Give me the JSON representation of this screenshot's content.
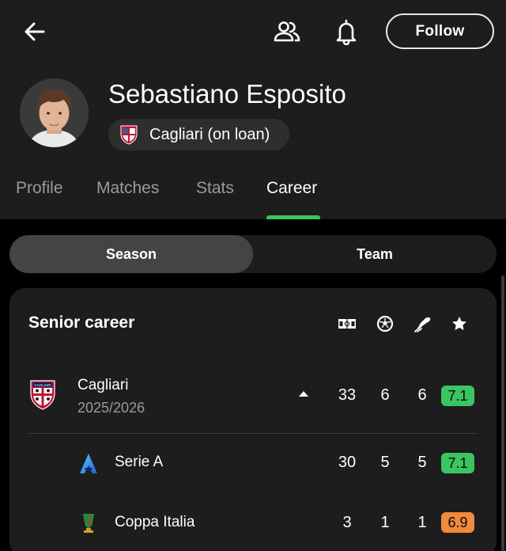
{
  "header": {
    "follow_label": "Follow",
    "icons": {
      "back": "arrow-left-icon",
      "people": "people-icon",
      "bell": "bell-icon"
    }
  },
  "player": {
    "name": "Sebastiano Esposito",
    "team_chip": "Cagliari (on loan)"
  },
  "tabs": [
    {
      "label": "Profile",
      "active": false
    },
    {
      "label": "Matches",
      "active": false
    },
    {
      "label": "Stats",
      "active": false
    },
    {
      "label": "Career",
      "active": true
    }
  ],
  "segment": {
    "season_label": "Season",
    "team_label": "Team",
    "selected": "Season"
  },
  "career": {
    "title": "Senior career",
    "columns": [
      "appearances-icon",
      "goals-icon",
      "assists-icon",
      "rating-icon"
    ],
    "club": {
      "name": "Cagliari",
      "season": "2025/2026",
      "appearances": "33",
      "goals": "6",
      "assists": "6",
      "rating": "7.1",
      "rating_color": "#39c561"
    },
    "competitions": [
      {
        "name": "Serie A",
        "icon": "serie-a-logo-icon",
        "appearances": "30",
        "goals": "5",
        "assists": "5",
        "rating": "7.1",
        "rating_color": "#39c561"
      },
      {
        "name": "Coppa Italia",
        "icon": "coppa-italia-logo-icon",
        "appearances": "3",
        "goals": "1",
        "assists": "1",
        "rating": "6.9",
        "rating_color": "#f08a3c"
      }
    ]
  },
  "colors": {
    "accent": "#39c561",
    "background": "#000000",
    "surface": "#1d1d1d"
  }
}
